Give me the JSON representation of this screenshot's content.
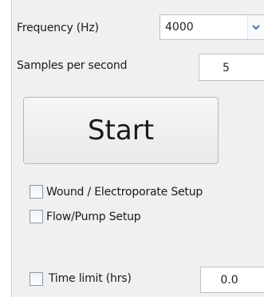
{
  "frequency": {
    "label": "Frequency (Hz)",
    "value": "4000"
  },
  "samples": {
    "label": "Samples per second",
    "value": "5"
  },
  "start_button": {
    "label": "Start"
  },
  "checkboxes": {
    "wound": {
      "label": "Wound / Electroporate Setup",
      "checked": false
    },
    "flow": {
      "label": "Flow/Pump Setup",
      "checked": false
    },
    "time_limit": {
      "label": "Time limit (hrs)",
      "checked": false
    }
  },
  "time_limit": {
    "value": "0.0"
  },
  "icons": {
    "dropdown": "chevron-down-icon"
  },
  "colors": {
    "panel_bg": "#f0f0ee",
    "field_border": "#b9c3cc",
    "checkbox_border": "#8a99ae"
  }
}
